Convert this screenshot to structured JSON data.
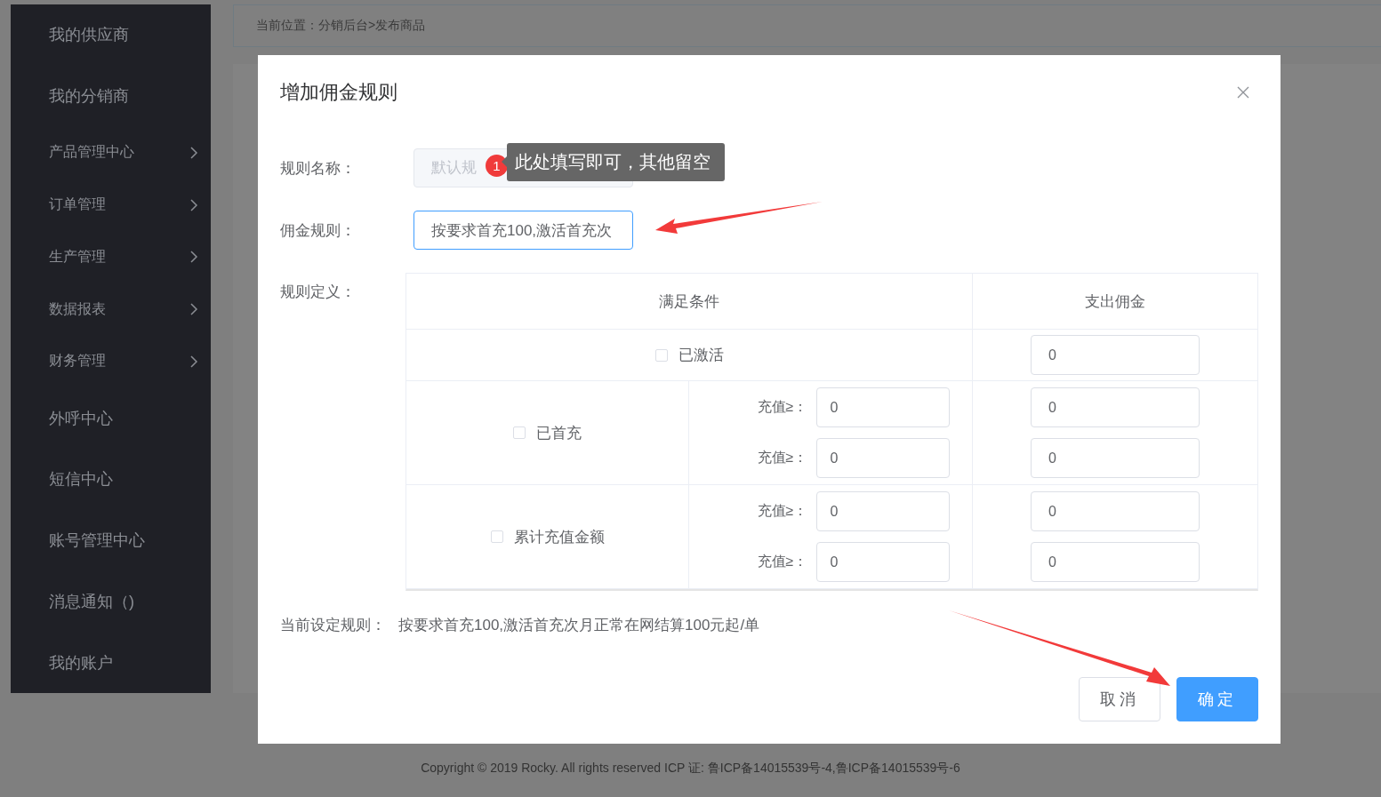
{
  "sidebar": {
    "items": [
      {
        "label": "我的供应商",
        "kind": "plain"
      },
      {
        "label": "我的分销商",
        "kind": "plain"
      },
      {
        "label": "产品管理中心",
        "kind": "expandable"
      },
      {
        "label": "订单管理",
        "kind": "expandable"
      },
      {
        "label": "生产管理",
        "kind": "expandable"
      },
      {
        "label": "数据报表",
        "kind": "expandable"
      },
      {
        "label": "财务管理",
        "kind": "expandable"
      },
      {
        "label": "外呼中心",
        "kind": "plain"
      },
      {
        "label": "短信中心",
        "kind": "plain"
      },
      {
        "label": "账号管理中心",
        "kind": "plain"
      },
      {
        "label": "消息通知（)",
        "kind": "plain"
      },
      {
        "label": "我的账户",
        "kind": "plain"
      }
    ]
  },
  "breadcrumb": "当前位置：分销后台>发布商品",
  "footer": {
    "copyright": "Copyright © 2019 Rocky. All rights reserved ICP 证: 鲁ICP备14015539号-4,鲁ICP备14015539号-6"
  },
  "dialog": {
    "title": "增加佣金规则",
    "fields": [
      {
        "label": "规则名称：",
        "placeholder": "默认规",
        "disabled": true
      },
      {
        "label": "佣金规则：",
        "value": "按要求首充100,激活首充次",
        "disabled": false
      }
    ],
    "badge": "1",
    "tooltip": "此处填写即可，其他留空",
    "definition_label": "规则定义：",
    "table": {
      "columns": [
        "满足条件",
        "支出佣金"
      ],
      "rows": [
        {
          "label": "已激活",
          "checked": false,
          "tiers": [
            {
              "payout": "0"
            }
          ]
        },
        {
          "label": "已首充",
          "checked": false,
          "tiers": [
            {
              "threshold_label": "充值≥：",
              "threshold": "0",
              "payout": "0"
            },
            {
              "threshold_label": "充值≥：",
              "threshold": "0",
              "payout": "0"
            }
          ]
        },
        {
          "label": "累计充值金额",
          "checked": false,
          "tiers": [
            {
              "threshold_label": "充值≥：",
              "threshold": "0",
              "payout": "0"
            },
            {
              "threshold_label": "充值≥：",
              "threshold": "0",
              "payout": "0"
            }
          ]
        }
      ]
    },
    "current_rule": {
      "label": "当前设定规则：",
      "value": "按要求首充100,激活首充次月正常在网结算100元起/单"
    },
    "buttons": [
      {
        "label": "取消",
        "kind": "default"
      },
      {
        "label": "确定",
        "kind": "primary"
      }
    ]
  }
}
